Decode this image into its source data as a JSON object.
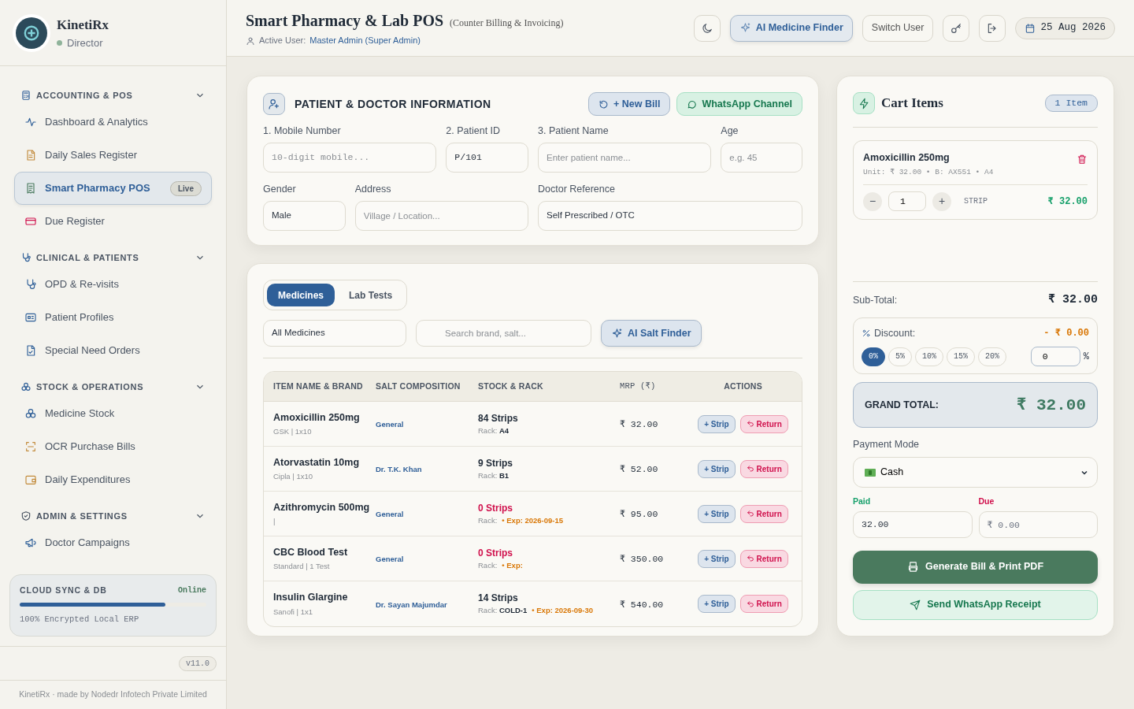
{
  "brand": {
    "name": "KinetiRx",
    "role": "Director",
    "online": true
  },
  "sidebar": {
    "sections": [
      {
        "title": "ACCOUNTING & POS",
        "expanded": true,
        "items": [
          {
            "label": "Dashboard & Analytics",
            "selected": false
          },
          {
            "label": "Daily Sales Register",
            "selected": false
          },
          {
            "label": "Smart Pharmacy POS",
            "selected": true,
            "badge": "Live"
          },
          {
            "label": "Due Register",
            "selected": false
          }
        ]
      },
      {
        "title": "CLINICAL & PATIENTS",
        "expanded": true,
        "items": [
          {
            "label": "OPD & Re-visits",
            "selected": false
          },
          {
            "label": "Patient Profiles",
            "selected": false
          },
          {
            "label": "Special Need Orders",
            "selected": false
          }
        ]
      },
      {
        "title": "STOCK & OPERATIONS",
        "expanded": true,
        "items": [
          {
            "label": "Medicine Stock",
            "selected": false
          },
          {
            "label": "OCR Purchase Bills",
            "selected": false
          },
          {
            "label": "Daily Expenditures",
            "selected": false
          }
        ]
      },
      {
        "title": "ADMIN & SETTINGS",
        "expanded": true,
        "items": [
          {
            "label": "Doctor Campaigns",
            "selected": false
          }
        ]
      }
    ],
    "sync": {
      "title": "CLOUD SYNC & DB",
      "status": "Online",
      "level": 0.78,
      "note": "100% Encrypted Local ERP"
    },
    "version": "v11.0",
    "footer": "KinetiRx · made by Nodedr Infotech Private Limited"
  },
  "header": {
    "title": "Smart Pharmacy & Lab POS",
    "subtitle": "(Counter Billing & Invoicing)",
    "user_label": "Active User:",
    "user": "Master Admin (Super Admin)",
    "ai_button": "AI Medicine Finder",
    "switch_button": "Switch User",
    "date": "25 Aug 2026"
  },
  "patient_card": {
    "title": "PATIENT & DOCTOR INFORMATION",
    "new_bill": "+ New Bill",
    "whatsapp": "WhatsApp Channel",
    "rows": [
      [
        {
          "kind": "input",
          "label": "1. Mobile Number",
          "placeholder": "10-digit mobile...",
          "mono": true
        },
        {
          "kind": "input",
          "label": "2. Patient ID",
          "value": "P/101",
          "mono": true
        },
        {
          "kind": "input",
          "label": "3. Patient Name",
          "placeholder": "Enter patient name..."
        },
        {
          "kind": "input",
          "label": "Age",
          "placeholder": "e.g. 45"
        }
      ],
      [
        {
          "kind": "select",
          "label": "Gender",
          "value": "Male"
        },
        {
          "kind": "input",
          "label": "Address",
          "placeholder": "Village / Location..."
        },
        {
          "kind": "select",
          "label": "Doctor Reference",
          "value": "Self Prescribed / OTC"
        }
      ]
    ]
  },
  "catalog": {
    "tabs": [
      {
        "label": "Medicines",
        "selected": true
      },
      {
        "label": "Lab Tests",
        "selected": false
      }
    ],
    "filter": "All Medicines",
    "search_placeholder": "Search brand, salt...",
    "ai_button": "AI Salt Finder",
    "columns": [
      "ITEM NAME & BRAND",
      "SALT COMPOSITION",
      "STOCK & RACK",
      "MRP (₹)",
      "ACTIONS"
    ],
    "rows": [
      {
        "name": "Amoxicillin 250mg",
        "brand": "GSK | 1x10",
        "salt": "General",
        "stock": "84 Strips",
        "out_of_stock": false,
        "rack_label": "Rack:",
        "rack": "A4",
        "mrp": "₹ 32.00",
        "add": "+ Strip",
        "return": "Return"
      },
      {
        "name": "Atorvastatin 10mg",
        "brand": "Cipla | 1x10",
        "salt": "Dr. T.K. Khan",
        "stock": "9 Strips",
        "out_of_stock": false,
        "rack_label": "Rack:",
        "rack": "B1",
        "mrp": "₹ 52.00",
        "add": "+ Strip",
        "return": "Return"
      },
      {
        "name": "Azithromycin 500mg",
        "brand": "|",
        "salt": "General",
        "stock": "0 Strips",
        "out_of_stock": true,
        "rack_label": "Rack:",
        "expiry": "• Exp: 2026-09-15",
        "mrp": "₹ 95.00",
        "add": "+ Strip",
        "return": "Return"
      },
      {
        "name": "CBC Blood Test",
        "brand": "Standard | 1 Test",
        "salt": "General",
        "stock": "0 Strips",
        "out_of_stock": true,
        "rack_label": "Rack:",
        "expiry": "• Exp:",
        "mrp": "₹ 350.00",
        "add": "+ Strip",
        "return": "Return"
      },
      {
        "name": "Insulin Glargine",
        "brand": "Sanofi | 1x1",
        "salt": "Dr. Sayan Majumdar",
        "stock": "14 Strips",
        "out_of_stock": false,
        "rack_label": "Rack:",
        "rack": "COLD-1",
        "expiry": "• Exp: 2026-09-30",
        "mrp": "₹ 540.00",
        "add": "+ Strip",
        "return": "Return"
      }
    ]
  },
  "cart": {
    "title": "Cart Items",
    "count": "1 Item",
    "items": [
      {
        "name": "Amoxicillin 250mg",
        "meta": "Unit: ₹ 32.00 • B: AX551 • A4",
        "minus": "−",
        "qty": "1",
        "plus": "+",
        "unit": "STRIP",
        "total": "₹ 32.00"
      }
    ],
    "subtotal_label": "Sub-Total:",
    "subtotal": "₹ 32.00",
    "discount": {
      "label": "Discount:",
      "amount": "- ₹ 0.00",
      "presets": [
        {
          "label": "0%",
          "selected": true
        },
        {
          "label": "5%",
          "selected": false
        },
        {
          "label": "10%",
          "selected": false
        },
        {
          "label": "15%",
          "selected": false
        },
        {
          "label": "20%",
          "selected": false
        }
      ],
      "value": "0",
      "suffix": "%"
    },
    "grand_label": "GRAND TOTAL:",
    "grand": "₹ 32.00",
    "payment_label": "Payment Mode",
    "payment": "Cash",
    "paid_label": "Paid",
    "paid": "32.00",
    "due_label": "Due",
    "due": "₹ 0.00",
    "generate": "Generate Bill & Print PDF",
    "send": "Send WhatsApp Receipt"
  }
}
